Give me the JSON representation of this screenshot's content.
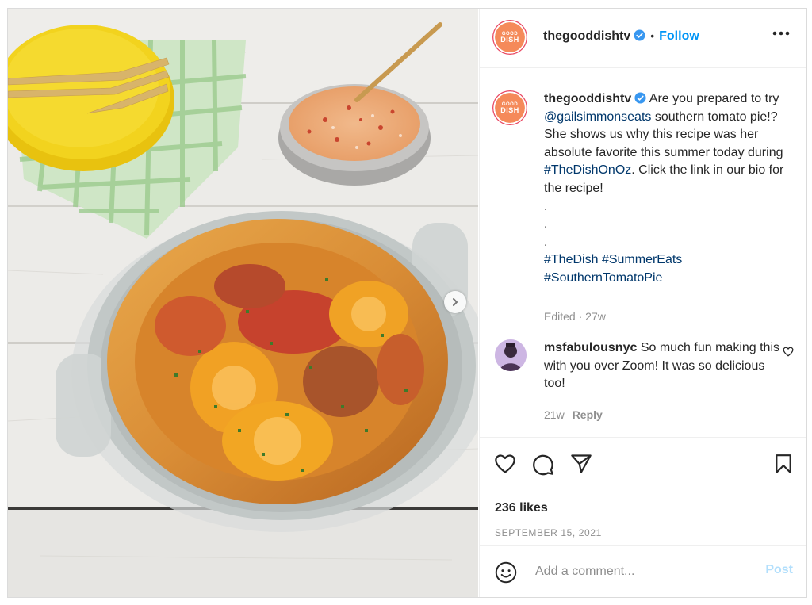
{
  "colors": {
    "accent": "#0095f6",
    "link": "#00376b",
    "muted": "#8e8e8e",
    "brand_logo": "#f58a5a"
  },
  "post": {
    "image_alt": "Southern tomato pie in a glass dish",
    "next_icon": "chevron-right-icon"
  },
  "header": {
    "logo_small": "GOOD",
    "logo_big": "DISH",
    "username": "thegooddishtv",
    "separator": "•",
    "follow_label": "Follow",
    "more_icon": "more-horizontal-icon"
  },
  "caption": {
    "username": "thegooddishtv",
    "text_1": "Are you prepared to try ",
    "mention": "@gailsimmonseats",
    "text_2": " southern tomato pie!? She shows us why this recipe was her absolute favorite this summer today during ",
    "hashtag_inline": "#TheDishOnOz",
    "text_3": ". Click the link in our bio for the recipe!",
    "dots": [
      ".",
      ".",
      "."
    ],
    "tag_1": "#TheDish",
    "tag_2": "#SummerEats",
    "tag_3": "#SouthernTomatoPie",
    "edited_label": "Edited",
    "age": "27w"
  },
  "comment": {
    "username": "msfabulousnyc",
    "text": "So much fun making this with you over Zoom! It was so delicious too!",
    "age": "21w",
    "reply_label": "Reply",
    "like_icon": "heart-outline-icon"
  },
  "actions": {
    "icons": [
      "heart-icon",
      "comment-icon",
      "share-icon",
      "bookmark-icon"
    ],
    "likes": "236 likes",
    "date": "SEPTEMBER 15, 2021"
  },
  "add_comment": {
    "emoji_icon": "emoji-icon",
    "placeholder": "Add a comment...",
    "post_label": "Post"
  }
}
